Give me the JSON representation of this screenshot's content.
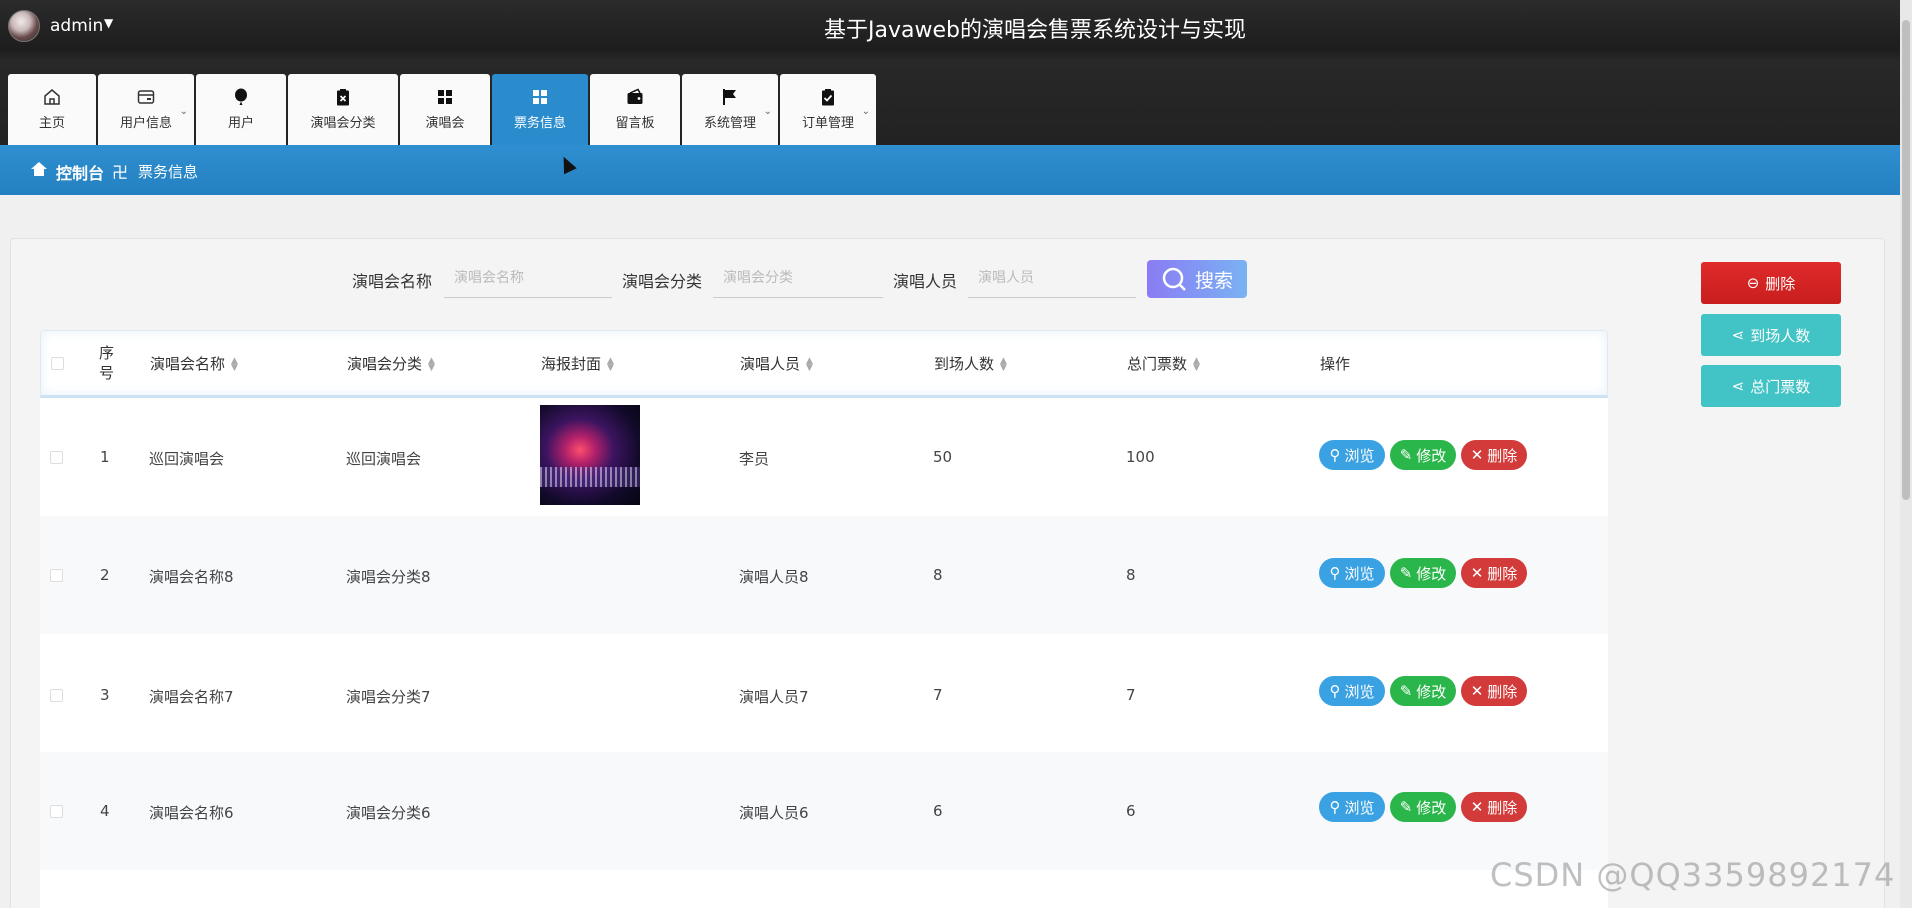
{
  "header": {
    "user": "admin",
    "title": "基于Javaweb的演唱会售票系统设计与实现"
  },
  "nav": [
    {
      "label": "主页",
      "icon": "home-icon"
    },
    {
      "label": "用户信息",
      "icon": "wallet-icon",
      "dropdown": true
    },
    {
      "label": "用户",
      "icon": "balloon-icon"
    },
    {
      "label": "演唱会分类",
      "icon": "clipboard-x-icon"
    },
    {
      "label": "演唱会",
      "icon": "grid-icon"
    },
    {
      "label": "票务信息",
      "icon": "grid-icon",
      "active": true
    },
    {
      "label": "留言板",
      "icon": "wallet-icon"
    },
    {
      "label": "系统管理",
      "icon": "flag-icon",
      "dropdown": true
    },
    {
      "label": "订单管理",
      "icon": "clipboard-check-icon",
      "dropdown": true
    }
  ],
  "breadcrumb": {
    "root": "控制台",
    "separator": "卍",
    "current": "票务信息"
  },
  "search": {
    "fields": [
      {
        "label": "演唱会名称",
        "placeholder": "演唱会名称"
      },
      {
        "label": "演唱会分类",
        "placeholder": "演唱会分类"
      },
      {
        "label": "演唱人员",
        "placeholder": "演唱人员"
      }
    ],
    "button": "搜索"
  },
  "side_buttons": {
    "delete": "删除",
    "attendance": "到场人数",
    "total": "总门票数"
  },
  "table": {
    "columns": [
      "序号",
      "演唱会名称",
      "演唱会分类",
      "海报封面",
      "演唱人员",
      "到场人数",
      "总门票数",
      "操作"
    ],
    "rows": [
      {
        "no": "1",
        "name": "巡回演唱会",
        "category": "巡回演唱会",
        "poster": true,
        "performer": "李员",
        "attendance": "50",
        "total": "100"
      },
      {
        "no": "2",
        "name": "演唱会名称8",
        "category": "演唱会分类8",
        "poster": false,
        "performer": "演唱人员8",
        "attendance": "8",
        "total": "8"
      },
      {
        "no": "3",
        "name": "演唱会名称7",
        "category": "演唱会分类7",
        "poster": false,
        "performer": "演唱人员7",
        "attendance": "7",
        "total": "7"
      },
      {
        "no": "4",
        "name": "演唱会名称6",
        "category": "演唱会分类6",
        "poster": false,
        "performer": "演唱人员6",
        "attendance": "6",
        "total": "6"
      }
    ],
    "actions": {
      "view": "浏览",
      "edit": "修改",
      "delete": "删除"
    }
  },
  "watermark": "CSDN @QQ3359892174",
  "colors": {
    "accent": "#2b8ccd",
    "danger": "#d33b3b",
    "success": "#2ab64a",
    "info": "#3aa1e3",
    "teal": "#42c3c5"
  }
}
